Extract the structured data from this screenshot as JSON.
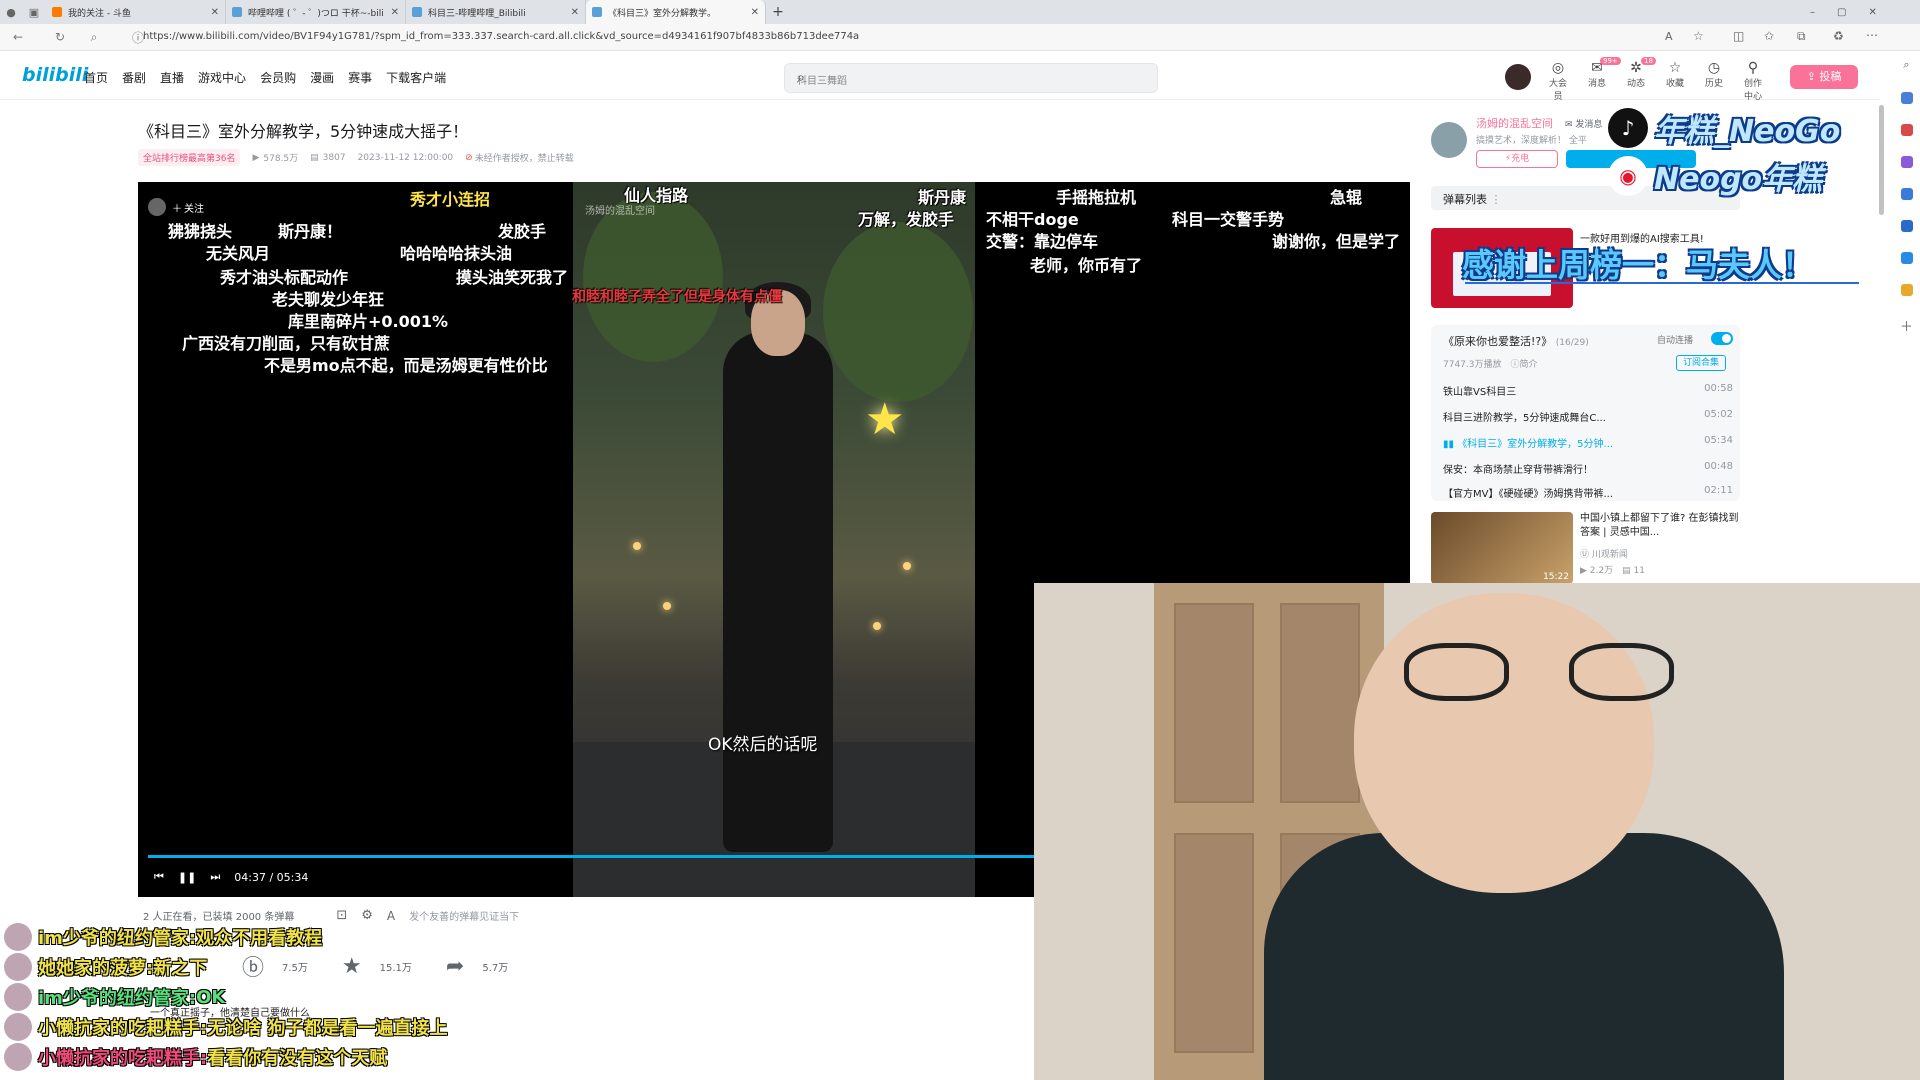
{
  "browser": {
    "tabs": [
      {
        "title": "我的关注 - 斗鱼",
        "active": false
      },
      {
        "title": "哔哩哔哩 ( ゜- ゜)つロ 干杯~-bili",
        "active": false
      },
      {
        "title": "科目三-哔哩哔哩_Bilibili",
        "active": false
      },
      {
        "title": "《科目三》室外分解教学。",
        "active": true
      }
    ],
    "new_tab": "+",
    "url": "https://www.bilibili.com/video/BV1F94y1G781/?spm_id_from=333.337.search-card.all.click&vd_source=d4934161f907bf4833b86b713dee774a"
  },
  "header": {
    "logo": "bilibili",
    "nav": [
      "首页",
      "番剧",
      "直播",
      "游戏中心",
      "会员购",
      "漫画",
      "赛事",
      "下载客户端"
    ],
    "search_placeholder": "科目三舞蹈",
    "icons": [
      {
        "label": "大会员",
        "icon": "member-icon"
      },
      {
        "label": "消息",
        "icon": "message-icon",
        "badge": "99+"
      },
      {
        "label": "动态",
        "icon": "dynamic-icon",
        "badge": "18"
      },
      {
        "label": "收藏",
        "icon": "favorite-icon"
      },
      {
        "label": "历史",
        "icon": "history-icon"
      },
      {
        "label": "创作中心",
        "icon": "creator-icon"
      }
    ],
    "upload": "投稿"
  },
  "video": {
    "title": "《科目三》室外分解教学，5分钟速成大摇子！",
    "rank": "全站排行榜最高第36名",
    "views": "578.5万",
    "danmaku": "3807",
    "date": "2023-11-12 12:00:00",
    "copyright": "未经作者授权，禁止转载",
    "follow_chip": "关注",
    "subtitle": "OK然后的话呢",
    "watermark": "汤姆的混乱空间",
    "time_current": "04:37",
    "time_total": "05:34",
    "progress": 0.829,
    "danmu_status": "2 人正在看，已装填 2000 条弹幕",
    "danmu_placeholder": "发个友善的弹幕见证当下"
  },
  "danmu": [
    "秀才小连招",
    "仙人指路",
    "斯丹康",
    "手摇拖拉机",
    "急辊",
    "狒狒挠头",
    "斯丹康！",
    "发胶手",
    "万解，发胶手",
    "不相干doge",
    "科目一交警手势",
    "无关风月",
    "哈哈哈哈抹头油",
    "交警：靠边停车",
    "谢谢你，但是学了",
    "秀才油头标配动作",
    "摸头油笑死我了",
    "老师，你币有了",
    "老夫聊发少年狂",
    "和睦和睦子弄全了但是身体有点僵",
    "库里南碎片+0.001%",
    "广西没有刀削面，只有砍甘蔗",
    "不是男mo点不起，而是汤姆更有性价比"
  ],
  "actions": {
    "coin": "7.5万",
    "favorite": "15.1万",
    "share": "5.7万"
  },
  "description": "一个真正摇子，他清楚自己要做什么",
  "uploader": {
    "name": "汤姆的混乱空间",
    "message": "发消息",
    "bio": "搞摸艺术，深度解析！ 全平",
    "charge": "充电"
  },
  "overlay": {
    "tiktok": "年糕_NeoGo",
    "weibo": "Neogo年糕",
    "thanks": "感谢上周榜一：马夫人！"
  },
  "sidebar": {
    "danmu_list": "弹幕列表",
    "ad_text": "一款好用到爆的AI搜索工具!",
    "playlist_title": "《原来你也爱整活!?》",
    "playlist_count": "(16/29)",
    "autoplay": "自动连播",
    "playlist_views": "7747.3万播放",
    "playlist_intro": "简介",
    "subscribe": "订阅合集",
    "playlist": [
      {
        "title": "铁山靠VS科目三",
        "dur": "00:58",
        "current": false
      },
      {
        "title": "科目三进阶教学，5分钟速成舞台C...",
        "dur": "05:02",
        "current": false
      },
      {
        "title": "《科目三》室外分解教学，5分钟...",
        "dur": "05:34",
        "current": true
      },
      {
        "title": "保安：本商场禁止穿背带裤滑行！",
        "dur": "00:48",
        "current": false
      },
      {
        "title": "【官方MV】《硬碰硬》汤姆携背带裤...",
        "dur": "02:11",
        "current": false
      }
    ],
    "rec2_title": "中国小镇上都留下了谁? 在彭镇找到答案 | 灵感中国...",
    "rec2_up": "川观新闻",
    "rec2_views": "2.2万",
    "rec2_danmaku": "11",
    "rec2_dur": "15:22"
  },
  "chat": [
    {
      "name": "im少爷的纽约管家:",
      "text": "观众不用看教程",
      "ncolor": "#f0e24a",
      "tcolor": "#f0e24a"
    },
    {
      "name": "她她家的菠萝:",
      "text": "新之下",
      "ncolor": "#f0e24a",
      "tcolor": "#f0e24a"
    },
    {
      "name": "im少爷的纽约管家:",
      "text": "OK",
      "ncolor": "#5ae07a",
      "tcolor": "#5ae07a"
    },
    {
      "name": "小懒抗家的吃耙糕手:",
      "text": "无论啥 狗子都是看一遍直接上",
      "ncolor": "#f0e24a",
      "tcolor": "#f0e24a"
    },
    {
      "name": "小懒抗家的吃耙糕手:",
      "text": "看看你有没有这个天赋",
      "ncolor": "#f04a7a",
      "tcolor": "#f0e24a"
    }
  ]
}
